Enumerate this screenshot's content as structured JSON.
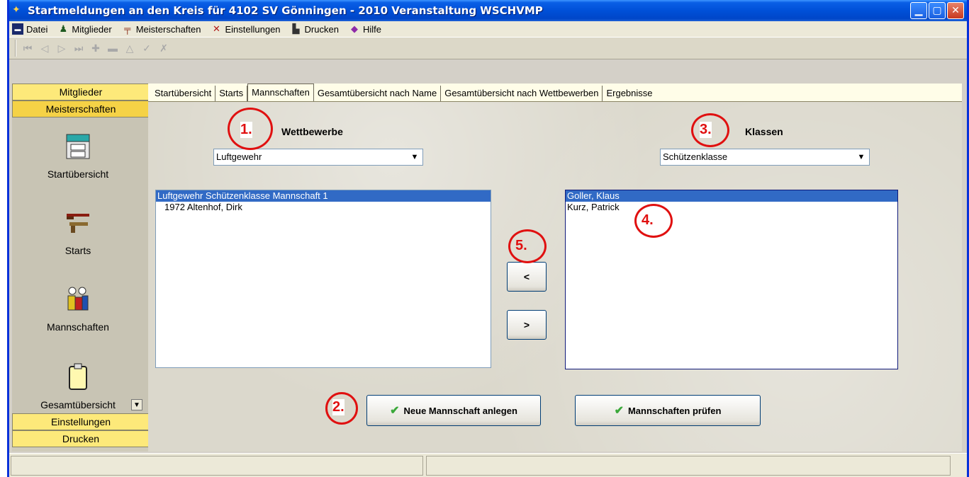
{
  "window": {
    "title": "Startmeldungen an den Kreis für 4102 SV Gönningen - 2010   Veranstaltung WSCHVMP"
  },
  "menu": [
    {
      "label": "Datei",
      "icon": "floppy-icon"
    },
    {
      "label": "Mitglieder",
      "icon": "person-icon"
    },
    {
      "label": "Meisterschaften",
      "icon": "rifle-icon"
    },
    {
      "label": "Einstellungen",
      "icon": "tools-icon"
    },
    {
      "label": "Drucken",
      "icon": "printer-icon"
    },
    {
      "label": "Hilfe",
      "icon": "help-book-icon"
    }
  ],
  "sidebar": {
    "header_mitglieder": "Mitglieder",
    "header_meisterschaften": "Meisterschaften",
    "items": [
      {
        "label": "Startübersicht",
        "icon": "cabinet-icon"
      },
      {
        "label": "Starts",
        "icon": "guns-icon"
      },
      {
        "label": "Mannschaften",
        "icon": "team-icon"
      },
      {
        "label": "Gesamtübersicht",
        "icon": "clipboard-icon"
      }
    ],
    "header_einstellungen": "Einstellungen",
    "header_drucken": "Drucken"
  },
  "tabs": [
    {
      "label": "Startübersicht",
      "active": false
    },
    {
      "label": "Starts",
      "active": false
    },
    {
      "label": "Mannschaften",
      "active": true
    },
    {
      "label": "Gesamtübersicht nach Name",
      "active": false
    },
    {
      "label": "Gesamtübersicht nach Wettbewerben",
      "active": false
    },
    {
      "label": "Ergebnisse",
      "active": false
    }
  ],
  "main": {
    "wettbewerbe_label": "Wettbewerbe",
    "wettbewerbe_value": "Luftgewehr",
    "klassen_label": "Klassen",
    "klassen_value": "Schützenklasse",
    "team_list": [
      {
        "text": "Luftgewehr Schützenklasse    Mannschaft 1",
        "selected": true
      },
      {
        "text": "1972 Altenhof, Dirk",
        "selected": false
      }
    ],
    "member_list": [
      {
        "text": "Goller, Klaus",
        "selected": true
      },
      {
        "text": "Kurz, Patrick",
        "selected": false
      }
    ],
    "move_left_label": "<",
    "move_right_label": ">",
    "new_team_button": "Neue Mannschaft anlegen",
    "check_teams_button": "Mannschaften prüfen"
  },
  "annotations": [
    "1.",
    "2.",
    "3.",
    "4.",
    "5."
  ]
}
